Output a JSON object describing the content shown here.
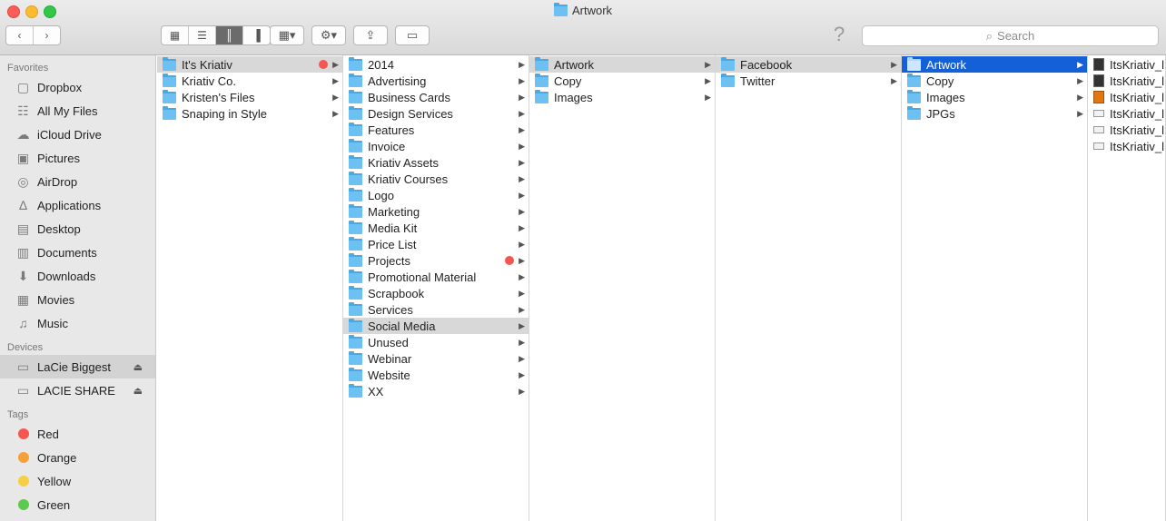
{
  "window": {
    "title": "Artwork"
  },
  "toolbar": {
    "back_icon": "chevron-left-icon",
    "forward_icon": "chevron-right-icon",
    "search_placeholder": "Search",
    "help_glyph": "?"
  },
  "sidebar": {
    "favorites_header": "Favorites",
    "favorites": [
      {
        "label": "Dropbox",
        "icon": "dropbox-icon"
      },
      {
        "label": "All My Files",
        "icon": "all-files-icon"
      },
      {
        "label": "iCloud Drive",
        "icon": "cloud-icon"
      },
      {
        "label": "Pictures",
        "icon": "camera-icon"
      },
      {
        "label": "AirDrop",
        "icon": "airdrop-icon"
      },
      {
        "label": "Applications",
        "icon": "applications-icon"
      },
      {
        "label": "Desktop",
        "icon": "desktop-icon"
      },
      {
        "label": "Documents",
        "icon": "documents-icon"
      },
      {
        "label": "Downloads",
        "icon": "downloads-icon"
      },
      {
        "label": "Movies",
        "icon": "film-icon"
      },
      {
        "label": "Music",
        "icon": "music-icon"
      }
    ],
    "devices_header": "Devices",
    "devices": [
      {
        "label": "LaCie Biggest",
        "selected": true
      },
      {
        "label": "LACIE SHARE",
        "selected": false
      }
    ],
    "tags_header": "Tags",
    "tags": [
      {
        "label": "Red",
        "color": "#f4574f"
      },
      {
        "label": "Orange",
        "color": "#f6a03a"
      },
      {
        "label": "Yellow",
        "color": "#f7cf45"
      },
      {
        "label": "Green",
        "color": "#5cc94f"
      }
    ]
  },
  "columns": [
    {
      "items": [
        {
          "label": "It's Kriativ",
          "state": "grey",
          "tag": true
        },
        {
          "label": "Kriativ Co."
        },
        {
          "label": "Kristen's Files"
        },
        {
          "label": "Snaping in Style"
        }
      ]
    },
    {
      "items": [
        {
          "label": "2014"
        },
        {
          "label": "Advertising"
        },
        {
          "label": "Business Cards"
        },
        {
          "label": "Design Services"
        },
        {
          "label": "Features"
        },
        {
          "label": "Invoice"
        },
        {
          "label": "Kriativ Assets"
        },
        {
          "label": "Kriativ Courses"
        },
        {
          "label": "Logo"
        },
        {
          "label": "Marketing"
        },
        {
          "label": "Media Kit"
        },
        {
          "label": "Price List"
        },
        {
          "label": "Projects",
          "tag": true
        },
        {
          "label": "Promotional Material"
        },
        {
          "label": "Scrapbook"
        },
        {
          "label": "Services"
        },
        {
          "label": "Social Media",
          "state": "grey"
        },
        {
          "label": "Unused"
        },
        {
          "label": "Webinar"
        },
        {
          "label": "Website"
        },
        {
          "label": "XX"
        }
      ]
    },
    {
      "items": [
        {
          "label": "Artwork",
          "state": "grey"
        },
        {
          "label": "Copy"
        },
        {
          "label": "Images"
        }
      ]
    },
    {
      "items": [
        {
          "label": "Facebook",
          "state": "grey"
        },
        {
          "label": "Twitter"
        }
      ]
    },
    {
      "items": [
        {
          "label": "Artwork",
          "state": "blue"
        },
        {
          "label": "Copy"
        },
        {
          "label": "Images"
        },
        {
          "label": "JPGs"
        }
      ]
    },
    {
      "files": [
        {
          "label": "ItsKriativ_l",
          "kind": "image"
        },
        {
          "label": "ItsKriativ_l",
          "kind": "image"
        },
        {
          "label": "ItsKriativ_l",
          "kind": "ai"
        },
        {
          "label": "ItsKriativ_l",
          "kind": "doc"
        },
        {
          "label": "ItsKriativ_l",
          "kind": "doc"
        },
        {
          "label": "ItsKriativ_l",
          "kind": "doc"
        }
      ]
    }
  ]
}
